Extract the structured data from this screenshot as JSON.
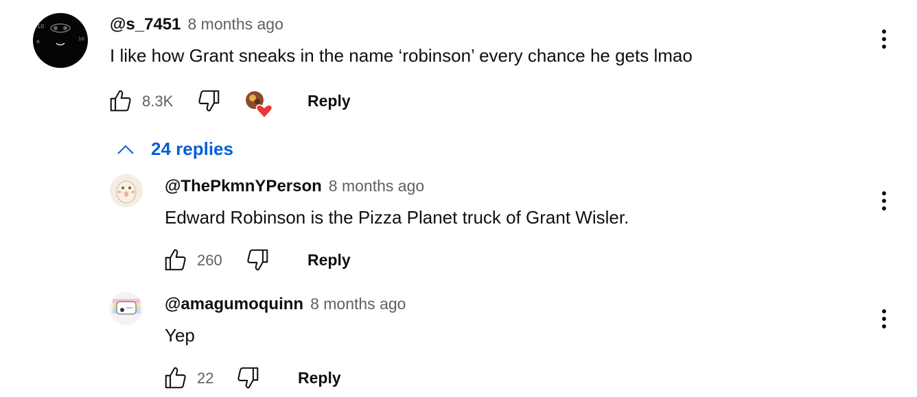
{
  "comment": {
    "author": "@s_7451",
    "time": "8 months ago",
    "text": "I like how Grant sneaks in the name ‘robinson’ every chance he gets lmao",
    "likes": "8.3K",
    "reply_label": "Reply",
    "replies_label": "24 replies"
  },
  "replies": [
    {
      "author": "@ThePkmnYPerson",
      "time": "8 months ago",
      "text": "Edward Robinson is the Pizza Planet truck of Grant Wisler.",
      "likes": "260",
      "reply_label": "Reply"
    },
    {
      "author": "@amagumoquinn",
      "time": "8 months ago",
      "text": "Yep",
      "likes": "22",
      "reply_label": "Reply"
    }
  ],
  "colors": {
    "text": "#0f0f0f",
    "secondary": "#606060",
    "link": "#065fd4",
    "heart": "#e53935"
  }
}
